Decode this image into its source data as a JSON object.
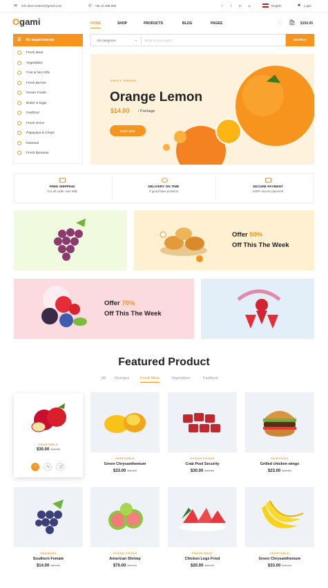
{
  "topbar": {
    "email": "info.deercreative@gmail.com",
    "phone": "+65 11.188.888",
    "social": [
      "f",
      "t",
      "in",
      "p"
    ],
    "language": "English",
    "login": "Login"
  },
  "header": {
    "logo_first": "O",
    "logo_rest": "gami",
    "nav": [
      "HOME",
      "SHOP",
      "PRODUCTS",
      "BLOG",
      "PAGES"
    ],
    "cart_total": "$150.00",
    "wishlist_count": "0",
    "cart_count": "0"
  },
  "departments": {
    "title": "All departments",
    "items": [
      "Fresh Meat",
      "Vegetables",
      "Fruit & Nut Gifts",
      "Fresh Berries",
      "Ocean Foods",
      "Butter & Eggs",
      "Fastfood",
      "Fresh Onion",
      "Papayaya & Crisps",
      "Oatmeal",
      "Fresh Bananas"
    ]
  },
  "search": {
    "category": "All Categories",
    "placeholder": "What do you need?",
    "button": "SEARCH"
  },
  "hero": {
    "eyebrow": "FRUIT FRESH",
    "title": "Orange Lemon",
    "price": "$14.00",
    "per": "/ Package",
    "button": "SHOP NOW"
  },
  "features": [
    {
      "title": "FREE SHIPPING",
      "sub": "For all order over 99$"
    },
    {
      "title": "DELIVERY ON TIME",
      "sub": "If good have prolems"
    },
    {
      "title": "SECURE PAYMENT",
      "sub": "100% secure payment"
    }
  ],
  "offers": [
    {
      "label": "Offer",
      "percent": "50%",
      "sub": "Off This The Week"
    },
    {
      "label": "Offer",
      "percent": "70%",
      "sub": "Off This The Week"
    }
  ],
  "featured": {
    "title": "Featured Product",
    "tabs": [
      "All",
      "Oranges",
      "Fresh Meat",
      "Vegetables",
      "Fastfood"
    ],
    "active_tab": "Fresh Meat"
  },
  "products": [
    {
      "category": "VEGETABLE",
      "name": "",
      "price": "$30.00",
      "old": "$45.00"
    },
    {
      "category": "VEGETABLE",
      "name": "Green Chrysanthemum",
      "price": "$33.00",
      "old": "$45.00"
    },
    {
      "category": "OCEAN FOODS",
      "name": "Crab Pool Security",
      "price": "$30.00",
      "old": "$45.00"
    },
    {
      "category": "FASTFOOD",
      "name": "Grilled chicken wings",
      "price": "$23.00",
      "old": "$45.00"
    },
    {
      "category": "ORANGES",
      "name": "Southern Female",
      "price": "$14.00",
      "old": "$35.00"
    },
    {
      "category": "OCEAN FOODS",
      "name": "American Shrimp",
      "price": "$70.00",
      "old": "$75.00"
    },
    {
      "category": "FRESH MEAT",
      "name": "Chicken Legs Fried",
      "price": "$20.00",
      "old": "$50.00"
    },
    {
      "category": "VEGETABLE",
      "name": "Green Chrysanthemum",
      "price": "$33.00",
      "old": "$45.00"
    }
  ]
}
